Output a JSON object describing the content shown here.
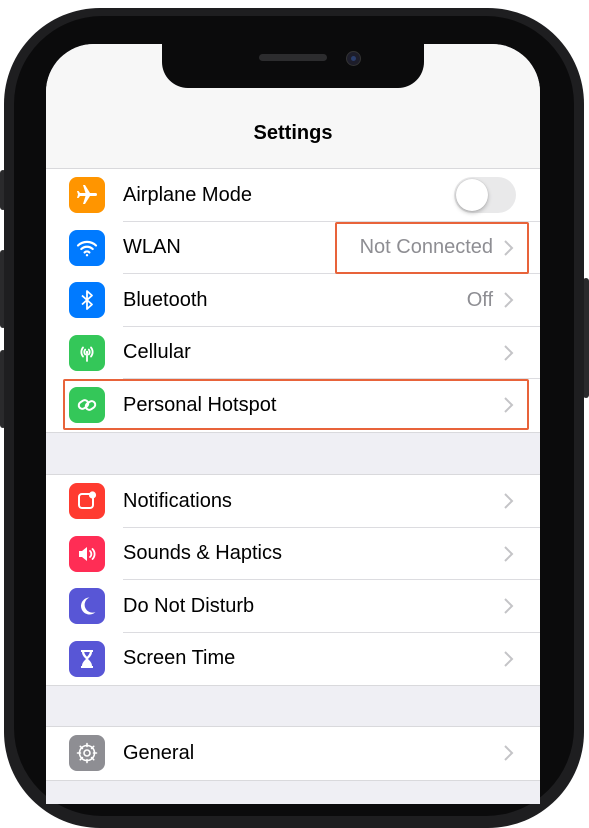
{
  "nav": {
    "title": "Settings"
  },
  "group1": [
    {
      "label": "Airplane Mode",
      "icon": "airplane-icon",
      "color": "#ff9500",
      "control": "toggle",
      "toggle_on": false
    },
    {
      "label": "WLAN",
      "icon": "wifi-icon",
      "color": "#007aff",
      "value": "Not Connected"
    },
    {
      "label": "Bluetooth",
      "icon": "bluetooth-icon",
      "color": "#007aff",
      "value": "Off"
    },
    {
      "label": "Cellular",
      "icon": "cellular-antenna-icon",
      "color": "#34c759"
    },
    {
      "label": "Personal Hotspot",
      "icon": "hotspot-link-icon",
      "color": "#34c759"
    }
  ],
  "group2": [
    {
      "label": "Notifications",
      "icon": "notifications-icon",
      "color": "#ff3b30"
    },
    {
      "label": "Sounds & Haptics",
      "icon": "speaker-icon",
      "color": "#ff2d55"
    },
    {
      "label": "Do Not Disturb",
      "icon": "moon-icon",
      "color": "#5856d6"
    },
    {
      "label": "Screen Time",
      "icon": "hourglass-icon",
      "color": "#5856d6"
    }
  ],
  "group3": [
    {
      "label": "General",
      "icon": "gear-icon",
      "color": "#8e8e93"
    }
  ],
  "highlight_color": "#e8633a"
}
